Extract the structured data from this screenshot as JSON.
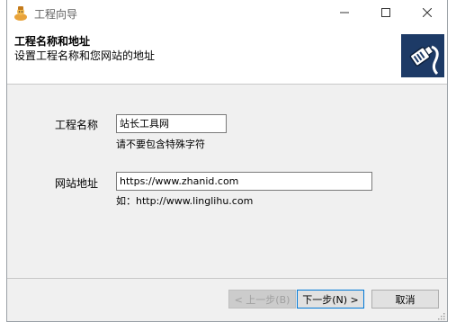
{
  "window": {
    "title": "工程向导"
  },
  "header": {
    "title": "工程名称和地址",
    "subtitle": "设置工程名称和您网站的地址"
  },
  "form": {
    "project_name": {
      "label": "工程名称",
      "value": "站长工具网",
      "hint": "请不要包含特殊字符"
    },
    "site_url": {
      "label": "网站地址",
      "value": "https://www.zhanid.com",
      "hint": "如：http://www.linglihu.com"
    }
  },
  "buttons": {
    "back": "< 上一步(B)",
    "next": "下一步(N) >",
    "cancel": "取消"
  },
  "icons": {
    "app": "installer-icon",
    "logo": "network-cable-icon",
    "minimize": "minimize-icon",
    "maximize": "maximize-icon",
    "close": "close-icon"
  },
  "colors": {
    "logo_bg": "#1d3a66",
    "primary_border": "#0078d7"
  }
}
